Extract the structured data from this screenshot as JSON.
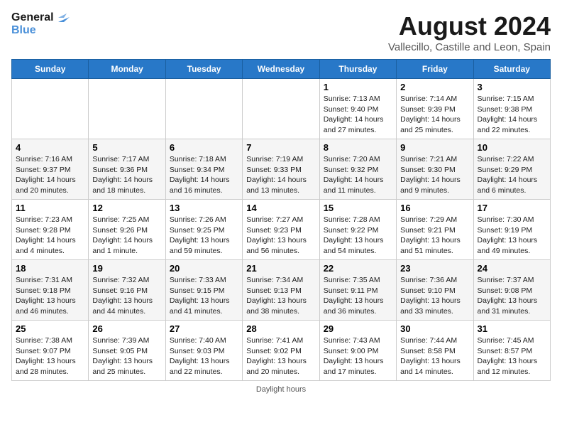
{
  "header": {
    "logo_line1": "General",
    "logo_line2": "Blue",
    "main_title": "August 2024",
    "subtitle": "Vallecillo, Castille and Leon, Spain"
  },
  "days_of_week": [
    "Sunday",
    "Monday",
    "Tuesday",
    "Wednesday",
    "Thursday",
    "Friday",
    "Saturday"
  ],
  "weeks": [
    [
      {
        "date": "",
        "text": ""
      },
      {
        "date": "",
        "text": ""
      },
      {
        "date": "",
        "text": ""
      },
      {
        "date": "",
        "text": ""
      },
      {
        "date": "1",
        "text": "Sunrise: 7:13 AM\nSunset: 9:40 PM\nDaylight: 14 hours and 27 minutes."
      },
      {
        "date": "2",
        "text": "Sunrise: 7:14 AM\nSunset: 9:39 PM\nDaylight: 14 hours and 25 minutes."
      },
      {
        "date": "3",
        "text": "Sunrise: 7:15 AM\nSunset: 9:38 PM\nDaylight: 14 hours and 22 minutes."
      }
    ],
    [
      {
        "date": "4",
        "text": "Sunrise: 7:16 AM\nSunset: 9:37 PM\nDaylight: 14 hours and 20 minutes."
      },
      {
        "date": "5",
        "text": "Sunrise: 7:17 AM\nSunset: 9:36 PM\nDaylight: 14 hours and 18 minutes."
      },
      {
        "date": "6",
        "text": "Sunrise: 7:18 AM\nSunset: 9:34 PM\nDaylight: 14 hours and 16 minutes."
      },
      {
        "date": "7",
        "text": "Sunrise: 7:19 AM\nSunset: 9:33 PM\nDaylight: 14 hours and 13 minutes."
      },
      {
        "date": "8",
        "text": "Sunrise: 7:20 AM\nSunset: 9:32 PM\nDaylight: 14 hours and 11 minutes."
      },
      {
        "date": "9",
        "text": "Sunrise: 7:21 AM\nSunset: 9:30 PM\nDaylight: 14 hours and 9 minutes."
      },
      {
        "date": "10",
        "text": "Sunrise: 7:22 AM\nSunset: 9:29 PM\nDaylight: 14 hours and 6 minutes."
      }
    ],
    [
      {
        "date": "11",
        "text": "Sunrise: 7:23 AM\nSunset: 9:28 PM\nDaylight: 14 hours and 4 minutes."
      },
      {
        "date": "12",
        "text": "Sunrise: 7:25 AM\nSunset: 9:26 PM\nDaylight: 14 hours and 1 minute."
      },
      {
        "date": "13",
        "text": "Sunrise: 7:26 AM\nSunset: 9:25 PM\nDaylight: 13 hours and 59 minutes."
      },
      {
        "date": "14",
        "text": "Sunrise: 7:27 AM\nSunset: 9:23 PM\nDaylight: 13 hours and 56 minutes."
      },
      {
        "date": "15",
        "text": "Sunrise: 7:28 AM\nSunset: 9:22 PM\nDaylight: 13 hours and 54 minutes."
      },
      {
        "date": "16",
        "text": "Sunrise: 7:29 AM\nSunset: 9:21 PM\nDaylight: 13 hours and 51 minutes."
      },
      {
        "date": "17",
        "text": "Sunrise: 7:30 AM\nSunset: 9:19 PM\nDaylight: 13 hours and 49 minutes."
      }
    ],
    [
      {
        "date": "18",
        "text": "Sunrise: 7:31 AM\nSunset: 9:18 PM\nDaylight: 13 hours and 46 minutes."
      },
      {
        "date": "19",
        "text": "Sunrise: 7:32 AM\nSunset: 9:16 PM\nDaylight: 13 hours and 44 minutes."
      },
      {
        "date": "20",
        "text": "Sunrise: 7:33 AM\nSunset: 9:15 PM\nDaylight: 13 hours and 41 minutes."
      },
      {
        "date": "21",
        "text": "Sunrise: 7:34 AM\nSunset: 9:13 PM\nDaylight: 13 hours and 38 minutes."
      },
      {
        "date": "22",
        "text": "Sunrise: 7:35 AM\nSunset: 9:11 PM\nDaylight: 13 hours and 36 minutes."
      },
      {
        "date": "23",
        "text": "Sunrise: 7:36 AM\nSunset: 9:10 PM\nDaylight: 13 hours and 33 minutes."
      },
      {
        "date": "24",
        "text": "Sunrise: 7:37 AM\nSunset: 9:08 PM\nDaylight: 13 hours and 31 minutes."
      }
    ],
    [
      {
        "date": "25",
        "text": "Sunrise: 7:38 AM\nSunset: 9:07 PM\nDaylight: 13 hours and 28 minutes."
      },
      {
        "date": "26",
        "text": "Sunrise: 7:39 AM\nSunset: 9:05 PM\nDaylight: 13 hours and 25 minutes."
      },
      {
        "date": "27",
        "text": "Sunrise: 7:40 AM\nSunset: 9:03 PM\nDaylight: 13 hours and 22 minutes."
      },
      {
        "date": "28",
        "text": "Sunrise: 7:41 AM\nSunset: 9:02 PM\nDaylight: 13 hours and 20 minutes."
      },
      {
        "date": "29",
        "text": "Sunrise: 7:43 AM\nSunset: 9:00 PM\nDaylight: 13 hours and 17 minutes."
      },
      {
        "date": "30",
        "text": "Sunrise: 7:44 AM\nSunset: 8:58 PM\nDaylight: 13 hours and 14 minutes."
      },
      {
        "date": "31",
        "text": "Sunrise: 7:45 AM\nSunset: 8:57 PM\nDaylight: 13 hours and 12 minutes."
      }
    ]
  ],
  "footer": {
    "daylight_label": "Daylight hours"
  }
}
